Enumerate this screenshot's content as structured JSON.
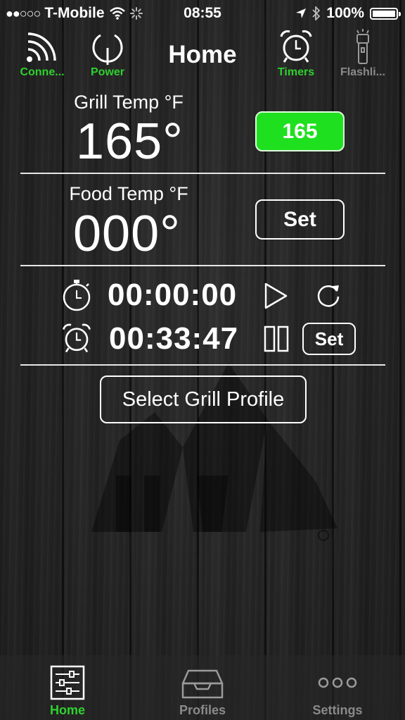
{
  "statusbar": {
    "signal_dots": "●●○○○",
    "carrier": "T-Mobile",
    "time": "08:55",
    "battery_percent": "100%",
    "battery_level": 1.0
  },
  "topnav": {
    "title": "Home",
    "items": [
      {
        "label": "Conne...",
        "icon": "wifi-signal-icon",
        "color": "#2fd12f"
      },
      {
        "label": "Power",
        "icon": "power-icon",
        "color": "#2fd12f"
      },
      {
        "label": "Timers",
        "icon": "alarm-clock-icon",
        "color": "#2fd12f"
      },
      {
        "label": "Flashli...",
        "icon": "flashlight-icon",
        "color": "#8a8a8a"
      }
    ]
  },
  "grill": {
    "label": "Grill Temp °F",
    "current": "165°",
    "setpoint_button": "165",
    "button_color": "#1fe01f"
  },
  "food": {
    "label": "Food Temp °F",
    "current": "000°",
    "set_button": "Set"
  },
  "stopwatch": {
    "time": "00:00:00",
    "icons": [
      "stopwatch-icon",
      "play-icon",
      "reset-icon"
    ]
  },
  "countdown": {
    "time": "00:33:47",
    "set_button": "Set",
    "icons": [
      "alarm-clock-icon",
      "pause-icon"
    ]
  },
  "profile_button": "Select Grill Profile",
  "tabbar": {
    "tabs": [
      {
        "label": "Home",
        "icon": "sliders-icon",
        "active": true,
        "color": "#2fd12f"
      },
      {
        "label": "Profiles",
        "icon": "tray-icon",
        "active": false,
        "color": "#8a8a8a"
      },
      {
        "label": "Settings",
        "icon": "more-dots-icon",
        "active": false,
        "color": "#8a8a8a"
      }
    ]
  }
}
